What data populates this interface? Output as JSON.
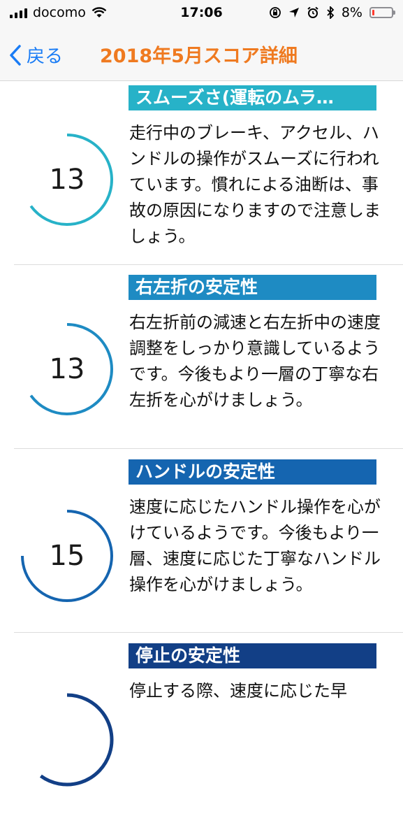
{
  "status": {
    "carrier": "docomo",
    "time": "17:06",
    "battery": "8%",
    "battery_level": 0.08,
    "signal_icon": "signal-bars-icon",
    "wifi_icon": "wifi-icon"
  },
  "nav": {
    "back_label": "戻る",
    "title": "2018年5月スコア詳細",
    "title_color": "#ef7a20",
    "back_color": "#1a7cf5"
  },
  "items": [
    {
      "heading": "スムーズさ(運転のムラ…",
      "score": "13",
      "color": "#27b2c8",
      "description": "走行中のブレーキ、アクセル、ハンドルの操作がスムーズに行われています。慣れによる油断は、事故の原因になりますので注意しましょう。"
    },
    {
      "heading": "右左折の安定性",
      "score": "13",
      "color": "#1e8bc3",
      "description": "右左折前の減速と右左折中の速度調整をしっかり意識しているようです。今後もより一層の丁寧な右左折を心がけましょう。"
    },
    {
      "heading": "ハンドルの安定性",
      "score": "15",
      "color": "#1565b0",
      "description": "速度に応じたハンドル操作を心がけているようです。今後もより一層、速度に応じた丁寧なハンドル操作を心がけましょう。"
    },
    {
      "heading": "停止の安定性",
      "score": "",
      "color": "#123f86",
      "description": "停止する際、速度に応じた早"
    }
  ]
}
